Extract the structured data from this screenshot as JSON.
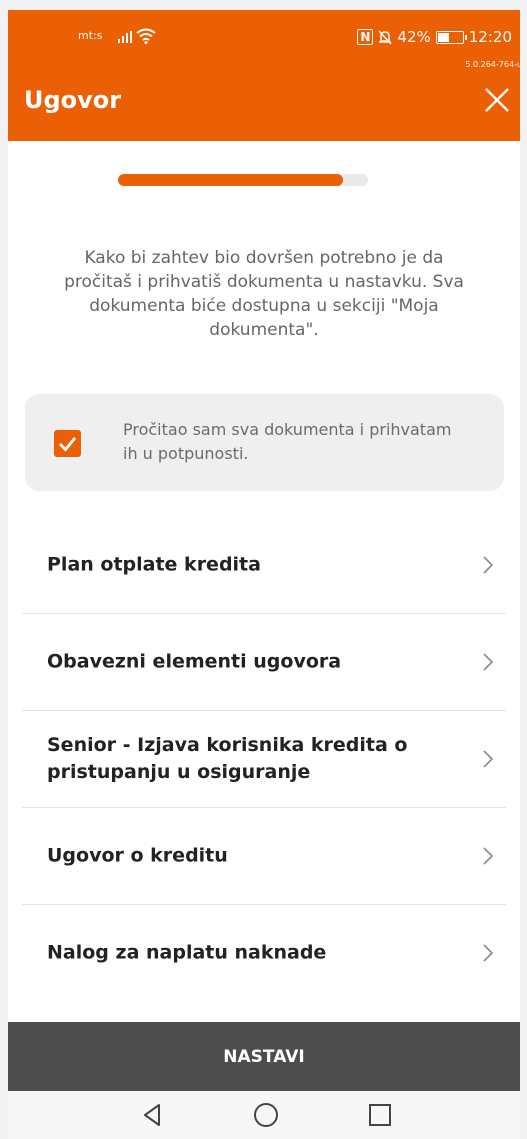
{
  "status_bar": {
    "carrier": "mt:s",
    "battery": "42%",
    "time": "12:20",
    "version": "5.0.264-764-u"
  },
  "header": {
    "title": "Ugovor",
    "close_icon": "close-icon"
  },
  "progress": {
    "value": 0.9
  },
  "intro_text": "Kako bi zahtev bio dovršen potrebno je da pročitaš i prihvatiš dokumenta u nastavku. Sva dokumenta biće dostupna u sekciji \"Moja dokumenta\".",
  "consent": {
    "checked": true,
    "text": "Pročitao sam sva dokumenta i prihvatam ih u potpunosti."
  },
  "documents": [
    {
      "label": "Plan otplate kredita"
    },
    {
      "label": "Obavezni elementi ugovora"
    },
    {
      "label": "Senior - Izjava korisnika kredita o pristupanju u osiguranje"
    },
    {
      "label": "Ugovor o kreditu"
    },
    {
      "label": "Nalog za naplatu naknade"
    }
  ],
  "continue_button": "NASTAVI",
  "nav_icons": [
    "back-triangle-icon",
    "home-circle-icon",
    "recents-square-icon"
  ],
  "colors": {
    "accent": "#ec6005",
    "button_bg": "#4d4d4d",
    "card_bg": "#efefef"
  }
}
